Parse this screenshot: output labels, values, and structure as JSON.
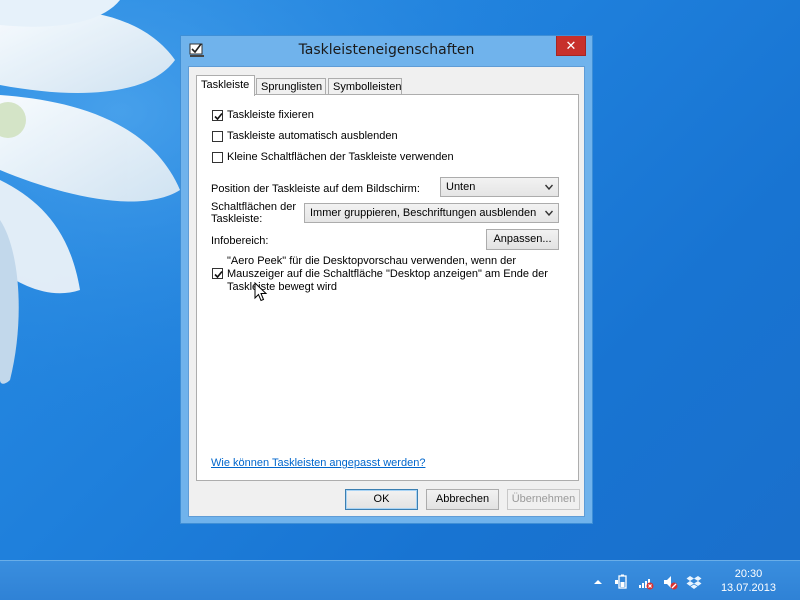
{
  "window": {
    "title": "Taskleisteneigenschaften",
    "close_label": "✕"
  },
  "tabs": [
    {
      "label": "Taskleiste",
      "active": true
    },
    {
      "label": "Sprunglisten",
      "active": false
    },
    {
      "label": "Symbolleisten",
      "active": false
    }
  ],
  "options": {
    "lock_taskbar": {
      "label": "Taskleiste fixieren",
      "checked": true
    },
    "auto_hide": {
      "label": "Taskleiste automatisch ausblenden",
      "checked": false
    },
    "small_buttons": {
      "label": "Kleine Schaltflächen der Taskleiste verwenden",
      "checked": false
    },
    "aero_peek": {
      "label_line1": "\"Aero Peek\" für die Desktopvorschau verwenden, wenn der",
      "label_line2": "Mauszeiger auf die Schaltfläche \"Desktop anzeigen\" am Ende der",
      "label_line3": "Taskleiste bewegt wird",
      "checked": true
    }
  },
  "position": {
    "label": "Position der Taskleiste auf dem Bildschirm:",
    "value": "Unten"
  },
  "buttons_setting": {
    "label_line1": "Schaltflächen der",
    "label_line2": "Taskleiste:",
    "value": "Immer gruppieren, Beschriftungen ausblenden"
  },
  "notification_area": {
    "label": "Infobereich:",
    "button_label": "Anpassen..."
  },
  "help_link": "Wie können Taskleisten angepasst werden?",
  "footer": {
    "ok_label": "OK",
    "cancel_label": "Abbrechen",
    "apply_label": "Übernehmen"
  },
  "taskbar": {
    "time": "20:30",
    "date": "13.07.2013",
    "tray_icons": [
      "chevron-up-icon",
      "battery-icon",
      "network-icon",
      "speaker-muted-icon",
      "dropbox-icon"
    ]
  }
}
